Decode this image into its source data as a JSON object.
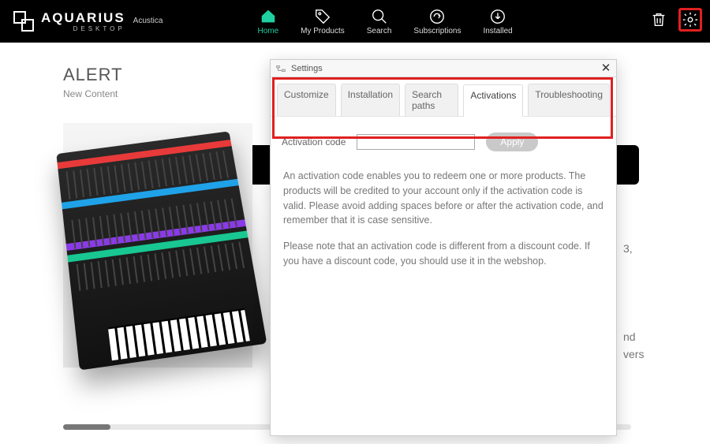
{
  "brand": {
    "main": "AQUARIUS",
    "sub": "DESKTOP",
    "vendor": "Acustica"
  },
  "nav": {
    "home": "Home",
    "products": "My Products",
    "search": "Search",
    "subs": "Subscriptions",
    "installed": "Installed"
  },
  "alert": {
    "title": "ALERT",
    "subtitle": "New Content"
  },
  "bg": {
    "line1": "3,",
    "line2": "nd",
    "line3": "vers"
  },
  "dialog": {
    "title": "Settings",
    "tabs": {
      "customize": "Customize",
      "installation": "Installation",
      "searchpaths": "Search paths",
      "activations": "Activations",
      "troubleshooting": "Troubleshooting"
    },
    "activation_label": "Activation code",
    "activation_value": "",
    "apply": "Apply",
    "info1": "An activation code enables you to redeem one or more products. The products will be credited to your account only if the activation code is valid. Please avoid adding spaces before or after the activation code, and remember that it is case sensitive.",
    "info2": "Please note that an activation code is different from a discount code. If you have a discount code, you should use it in the webshop."
  }
}
